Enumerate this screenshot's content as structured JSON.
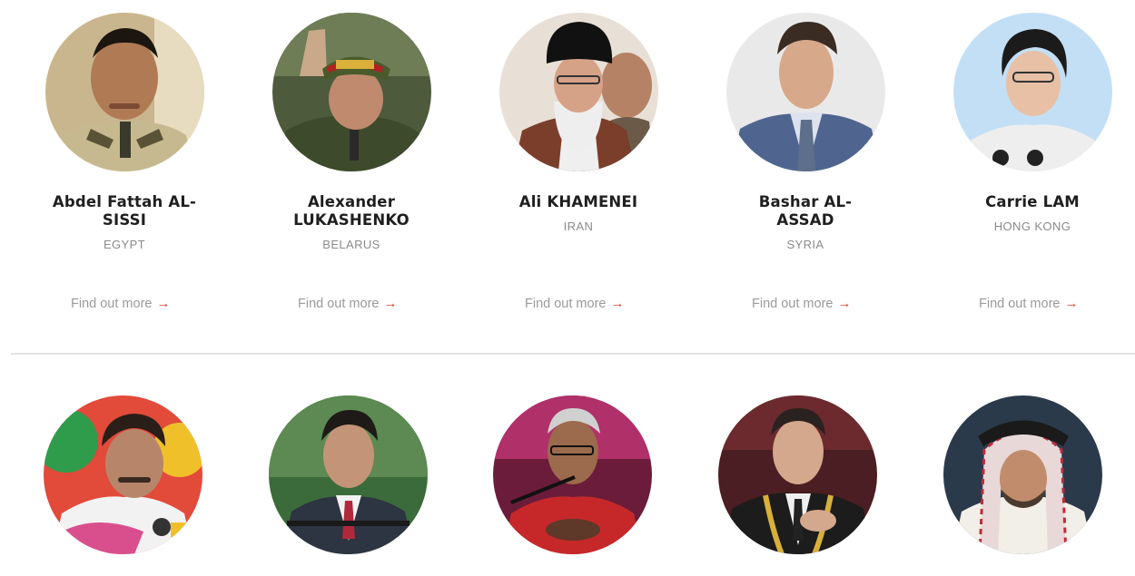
{
  "leaders_row1": [
    {
      "name": "Abdel Fattah AL-SISSI",
      "country": "EGYPT",
      "link": "Find out more",
      "icon": "arrow-right-icon"
    },
    {
      "name": "Alexander LUKASHENKO",
      "country": "BELARUS",
      "link": "Find out more",
      "icon": "arrow-right-icon"
    },
    {
      "name": "Ali KHAMENEI",
      "country": "IRAN",
      "link": "Find out more",
      "icon": "arrow-right-icon"
    },
    {
      "name": "Bashar AL-ASSAD",
      "country": "SYRIA",
      "link": "Find out more",
      "icon": "arrow-right-icon"
    },
    {
      "name": "Carrie LAM",
      "country": "HONG KONG",
      "link": "Find out more",
      "icon": "arrow-right-icon"
    }
  ],
  "arrow": "→",
  "colors": {
    "accent": "#e0402e",
    "text": "#1f1f1f",
    "muted": "#8a8a8a",
    "divider": "#e4e4e4"
  }
}
